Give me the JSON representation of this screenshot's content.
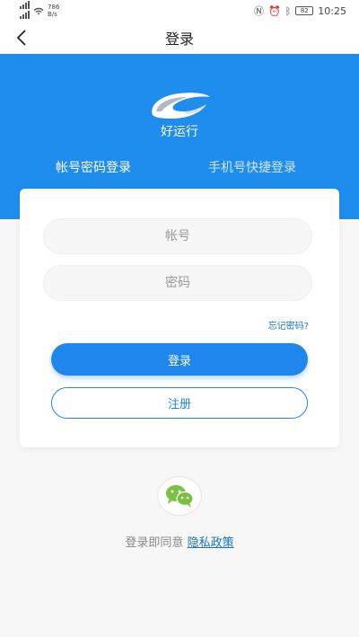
{
  "status_bar": {
    "net_speed": "786",
    "net_unit": "B/s",
    "battery": "82",
    "time": "10:25"
  },
  "header": {
    "title": "登录"
  },
  "brand": {
    "app_name": "好运行"
  },
  "tabs": [
    {
      "label": "帐号密码登录",
      "active": true
    },
    {
      "label": "手机号快捷登录",
      "active": false
    }
  ],
  "form": {
    "account_placeholder": "帐号",
    "password_placeholder": "密码",
    "forgot_label": "忘记密码?",
    "login_label": "登录",
    "register_label": "注册"
  },
  "footer": {
    "agree_text": "登录即同意",
    "privacy_link": "隐私政策"
  },
  "icons": {
    "back": "chevron-left-icon",
    "wechat": "wechat-icon",
    "logo": "app-logo"
  },
  "colors": {
    "primary": "#1f8ded",
    "button": "#1f86ee",
    "link": "#1a73c4",
    "wechat": "#7ac143"
  }
}
